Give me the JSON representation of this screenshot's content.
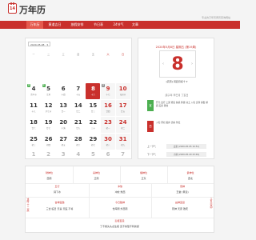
{
  "header": {
    "logo_number": "14",
    "title": "万年历",
    "tagline": "专业的万年历黄历查询网站"
  },
  "nav": {
    "items": [
      {
        "label": "万年历",
        "active": true
      },
      {
        "label": "黄道吉日",
        "active": false
      },
      {
        "label": "放假安排",
        "active": false
      },
      {
        "label": "节日表",
        "active": false
      },
      {
        "label": "24节气",
        "active": false
      },
      {
        "label": "文章",
        "active": false
      }
    ]
  },
  "calendar": {
    "selected_month": "2020-05-08",
    "weekdays": [
      "一",
      "二",
      "三",
      "四",
      "五",
      "六",
      "日"
    ],
    "week1": [
      {
        "day": "4",
        "lunar": "青年节",
        "badge": "休"
      },
      {
        "day": "5",
        "lunar": "立夏",
        "badge": "休"
      },
      {
        "day": "6",
        "lunar": "十四",
        "badge": ""
      },
      {
        "day": "7",
        "lunar": "十五",
        "badge": ""
      },
      {
        "day": "8",
        "lunar": "十六",
        "badge": ""
      },
      {
        "day": "9",
        "lunar": "十七",
        "badge": "班"
      },
      {
        "day": "10",
        "lunar": "母亲节",
        "badge": ""
      }
    ],
    "week2": [
      {
        "day": "11",
        "lunar": "十九",
        "badge": ""
      },
      {
        "day": "12",
        "lunar": "护士节",
        "badge": ""
      },
      {
        "day": "13",
        "lunar": "廿一",
        "badge": ""
      },
      {
        "day": "14",
        "lunar": "廿二",
        "badge": ""
      },
      {
        "day": "15",
        "lunar": "廿三",
        "badge": ""
      },
      {
        "day": "16",
        "lunar": "廿四",
        "badge": ""
      },
      {
        "day": "17",
        "lunar": "廿五",
        "badge": ""
      }
    ],
    "week3": [
      {
        "day": "18",
        "lunar": "廿六",
        "badge": ""
      },
      {
        "day": "19",
        "lunar": "廿七",
        "badge": ""
      },
      {
        "day": "20",
        "lunar": "小满",
        "badge": ""
      },
      {
        "day": "21",
        "lunar": "廿九",
        "badge": ""
      },
      {
        "day": "22",
        "lunar": "三十",
        "badge": ""
      },
      {
        "day": "23",
        "lunar": "初一",
        "badge": ""
      },
      {
        "day": "24",
        "lunar": "初二",
        "badge": ""
      }
    ],
    "week4": [
      {
        "day": "25",
        "lunar": "初三",
        "badge": ""
      },
      {
        "day": "26",
        "lunar": "初四",
        "badge": ""
      },
      {
        "day": "27",
        "lunar": "初五",
        "badge": ""
      },
      {
        "day": "28",
        "lunar": "初六",
        "badge": ""
      },
      {
        "day": "29",
        "lunar": "初七",
        "badge": ""
      },
      {
        "day": "30",
        "lunar": "初八",
        "badge": ""
      },
      {
        "day": "31",
        "lunar": "初九",
        "badge": ""
      }
    ],
    "week5": [
      {
        "day": "1",
        "lunar": "儿童节",
        "badge": ""
      },
      {
        "day": "2",
        "lunar": "十一",
        "badge": ""
      },
      {
        "day": "3",
        "lunar": "十二",
        "badge": ""
      },
      {
        "day": "4",
        "lunar": "十三",
        "badge": ""
      },
      {
        "day": "5",
        "lunar": "芒种",
        "badge": ""
      },
      {
        "day": "6",
        "lunar": "十五",
        "badge": ""
      },
      {
        "day": "7",
        "lunar": "十六",
        "badge": ""
      }
    ]
  },
  "detail": {
    "header": "2020年5月8日 星期五 (第19周)",
    "big_day": "8",
    "lunar": "[农历] 闰四月初十 ▾",
    "ganzhi": "庚子年 辛巳月 丁亥日",
    "yi_label": "宜",
    "yi_text": "开光 出行 上梁 修造 纳采 移徙 动土 入宅 安葬 嫁娶 求嗣 盖屋 竖柱",
    "ji_label": "忌",
    "ji_text": "入宅 祭祀 掘井 治病 作灶",
    "prev_term_label": "上一节气",
    "prev_term": "立夏 (2020-05-05 10:51)",
    "next_term_label": "下一节气",
    "next_term": "小满 (2020-05-20 23:49)"
  },
  "info": {
    "row1": [
      {
        "label": "财神位",
        "value": "西南"
      },
      {
        "label": "喜神位",
        "value": "正南"
      },
      {
        "label": "福神位",
        "value": "正东"
      },
      {
        "label": "贵神位",
        "value": "西北"
      }
    ],
    "row2": [
      {
        "label": "五行",
        "value": "涧下水"
      },
      {
        "label": "冲煞",
        "value": "冲蛇 煞西"
      },
      {
        "label": "值神",
        "value": "玉堂 (黄道)"
      }
    ],
    "row3": [
      {
        "label": "吉神宜趋",
        "value": "三合 临日 天喜 天医 不将"
      },
      {
        "label": "今日胎神",
        "value": "仓库厕 外西南"
      },
      {
        "label": "凶神宜忌",
        "value": "死神 天吏 致死"
      }
    ],
    "row4": {
      "label": "彭祖百忌",
      "value": "丁不剃头头必生疮 亥不嫁娶不利新郎"
    },
    "left_side": "逢时十二辰",
    "right_side": "子丑寅卯"
  }
}
